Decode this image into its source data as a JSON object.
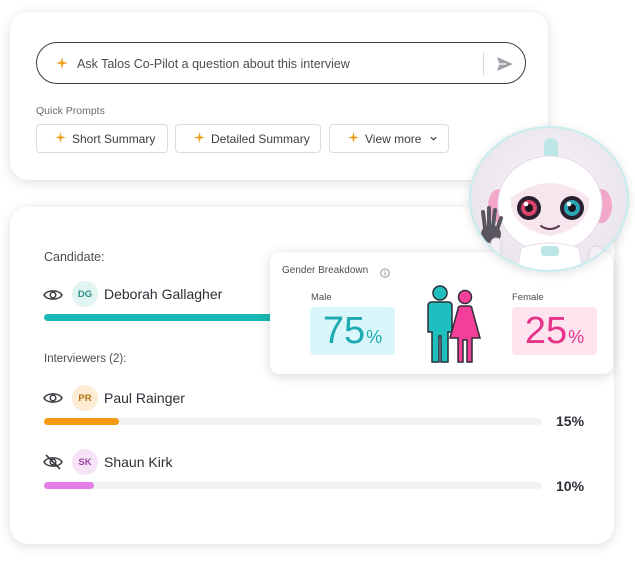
{
  "ask_bar": {
    "placeholder": "Ask Talos Co-Pilot a question about this interview"
  },
  "quick_prompts": {
    "label": "Quick Prompts",
    "buttons": [
      {
        "label": "Short Summary"
      },
      {
        "label": "Detailed Summary"
      },
      {
        "label": "View more"
      }
    ]
  },
  "candidate": {
    "label": "Candidate:",
    "initials": "DG",
    "name": "Deborah Gallagher",
    "bar_fraction": 0.75,
    "bar_color": "#19b8b4"
  },
  "interviewers": {
    "label": "Interviewers (2):",
    "list": [
      {
        "initials": "PR",
        "name": "Paul Rainger",
        "percent": "15%",
        "bar_fraction": 0.15,
        "bar_color": "#f39c12",
        "visible": true
      },
      {
        "initials": "SK",
        "name": "Shaun Kirk",
        "percent": "10%",
        "bar_fraction": 0.1,
        "bar_color": "#e27ee6",
        "visible": false
      }
    ]
  },
  "gender_breakdown": {
    "title": "Gender Breakdown",
    "male": {
      "label": "Male",
      "value": "75",
      "unit": "%",
      "color": "#1ca9b0"
    },
    "female": {
      "label": "Female",
      "value": "25",
      "unit": "%",
      "color": "#e5348a"
    }
  },
  "colors": {
    "accent_spark": "#f0a020",
    "male_fill": "#1fbfbf",
    "female_fill": "#f43f9a"
  },
  "icons": {
    "spark": "sparkle-icon",
    "send": "send-icon",
    "eye": "eye-icon",
    "eye_off": "eye-off-icon",
    "info": "info-icon",
    "chevron": "chevron-down-icon"
  }
}
